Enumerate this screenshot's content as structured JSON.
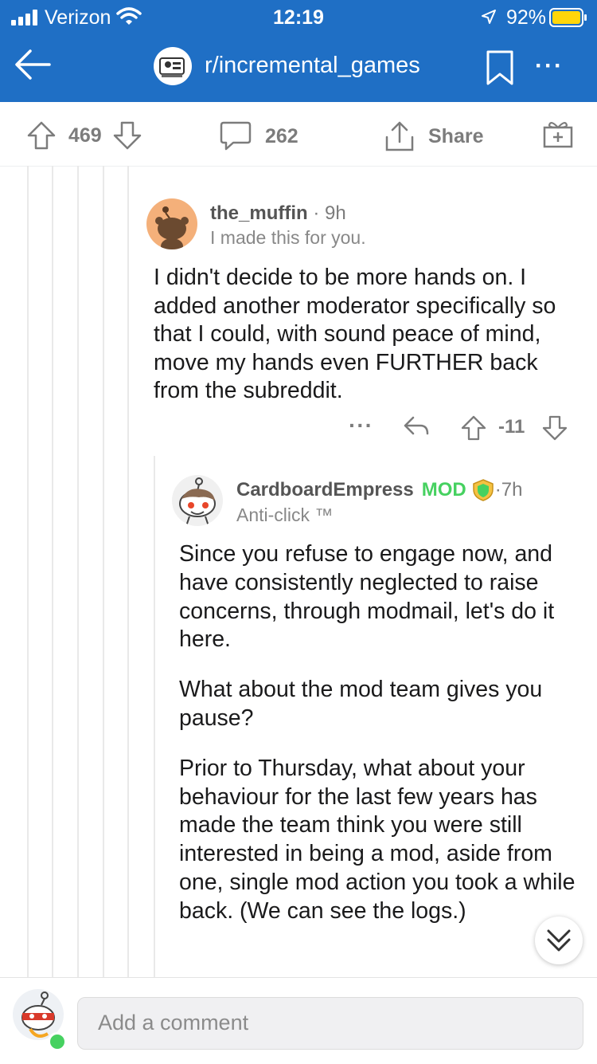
{
  "status": {
    "carrier": "Verizon",
    "time": "12:19",
    "battery": "92%"
  },
  "nav": {
    "subreddit": "r/incremental_games",
    "more_label": "···"
  },
  "actions": {
    "upvotes": "469",
    "comments": "262",
    "share": "Share"
  },
  "comment1": {
    "username": "the_muffin",
    "separator": " · ",
    "age": "9h",
    "flair": "I made this for you.",
    "body": "I didn't decide to be more hands on. I added another moderator specifically so that I could, with sound peace of mind, move my hands even FURTHER back from the subreddit.",
    "dots": "···",
    "score": "-11"
  },
  "comment2": {
    "username": "CardboardEmpress",
    "mod": "MOD",
    "separator": " · ",
    "age": "7h",
    "flair": "Anti-click ™",
    "paragraphs": [
      "Since you refuse to engage now, and have consistently neglected to raise concerns, through modmail, let's do it here.",
      "What about the mod team gives you pause?",
      "Prior to Thursday, what about your behaviour for the last few years has made the team think you were still interested in being a mod, aside from one, single mod action you took a while back.  (We can see the logs.)"
    ]
  },
  "composer": {
    "placeholder": "Add a comment"
  },
  "colors": {
    "header": "#1f6fc5",
    "mod_green": "#46d160",
    "meta_grey": "#7c7c7c"
  }
}
